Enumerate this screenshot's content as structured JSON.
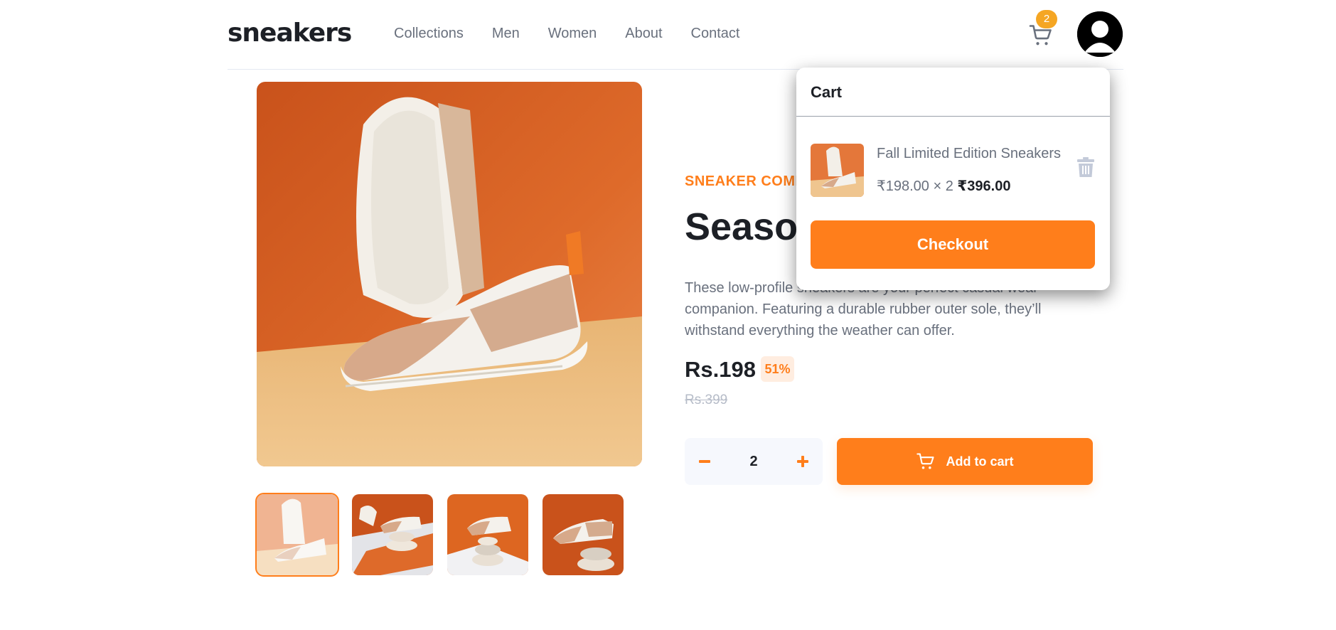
{
  "header": {
    "logo": "sneakers",
    "nav": [
      "Collections",
      "Men",
      "Women",
      "About",
      "Contact"
    ],
    "cart_count": "2"
  },
  "product": {
    "company": "SNEAKER COMP",
    "title": "Season",
    "description": "These low-profile sneakers are your perfect casual wear companion. Featuring a durable rubber outer sole, they’ll withstand everything the weather can offer.",
    "price": "Rs.198",
    "discount": "51%",
    "old_price": "Rs.399",
    "quantity": "2",
    "add_to_cart_label": "Add to cart"
  },
  "cart": {
    "title": "Cart",
    "item_name": "Fall Limited Edition Sneakers",
    "item_unit": "₹198.00 × 2",
    "item_total": "₹396.00",
    "checkout_label": "Checkout"
  },
  "colors": {
    "accent": "#ff7e1b",
    "accent_light": "#ffede0",
    "badge": "#f5a623",
    "text_dark": "#1d2026",
    "text_muted": "#69707d"
  },
  "icons": [
    "cart-icon",
    "avatar-icon",
    "minus-icon",
    "plus-icon",
    "trash-icon"
  ]
}
